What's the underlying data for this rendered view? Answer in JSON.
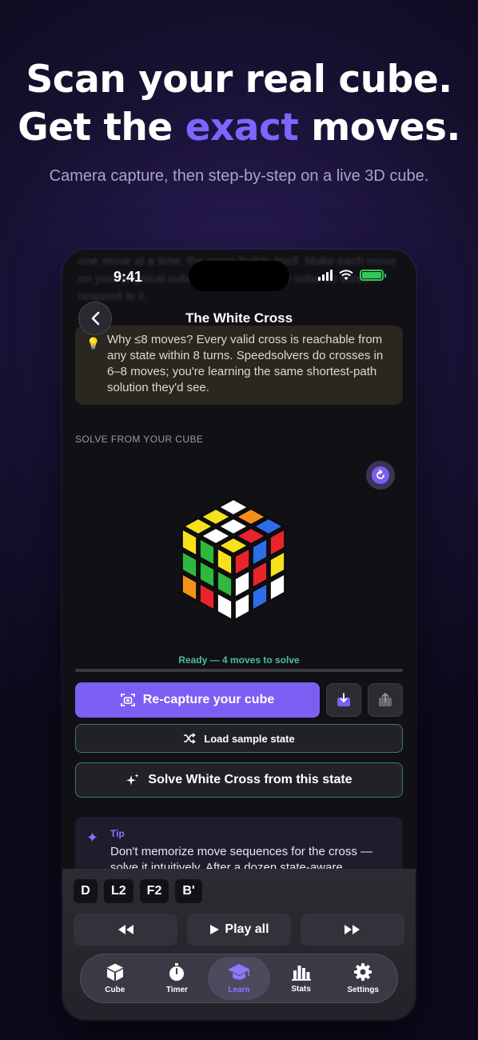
{
  "hero": {
    "line1": "Scan your real cube.",
    "line2_prefix": "Get the ",
    "line2_accent": "exact",
    "line2_suffix": " moves.",
    "subtitle": "Camera capture, then step-by-step on a live 3D cube."
  },
  "status_bar": {
    "time": "9:41"
  },
  "nav": {
    "title": "The White Cross"
  },
  "background_text": "one move at a time, the cross builds itself. Make each move on your physical cube and watch the 3D cube on screen respond to it.",
  "info_card": {
    "text": "Why ≤8 moves? Every valid cross is reachable from any state within 8 turns. Speedsolvers do crosses in 6–8 moves; you're learning the same shortest-path solution they'd see."
  },
  "solve_section": {
    "label": "SOLVE FROM YOUR CUBE",
    "status": "Ready — 4 moves to solve",
    "progress": 0
  },
  "buttons": {
    "recapture": "Re-capture your cube",
    "load_sample": "Load sample state",
    "solve": "Solve White Cross from this state"
  },
  "tip": {
    "label": "Tip",
    "text": "Don't memorize move sequences for the cross — solve it intuitively. After a dozen state-aware"
  },
  "moves": [
    "D",
    "L2",
    "F2",
    "B'"
  ],
  "playback": {
    "play_all": "Play all"
  },
  "tabs": [
    {
      "label": "Cube",
      "icon": "cube-icon"
    },
    {
      "label": "Timer",
      "icon": "stopwatch-icon"
    },
    {
      "label": "Learn",
      "icon": "graduation-cap-icon",
      "active": true
    },
    {
      "label": "Stats",
      "icon": "bar-chart-icon"
    },
    {
      "label": "Settings",
      "icon": "gear-icon"
    }
  ],
  "colors": {
    "accent": "#7b5ff2",
    "success": "#4bbf94",
    "cube_red": "#e8242b",
    "cube_green": "#2fb83d",
    "cube_blue": "#2d6ee8",
    "cube_yellow": "#f7e11a",
    "cube_orange": "#f59017",
    "cube_white": "#ffffff"
  }
}
